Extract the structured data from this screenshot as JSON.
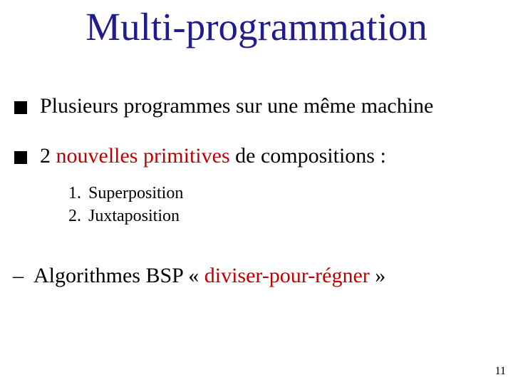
{
  "colors": {
    "title": "#1F1C8E",
    "accent": "#C00000",
    "text": "#000000",
    "bg": "#FFFFFF"
  },
  "title": "Multi-programmation",
  "bullets": [
    {
      "text": "Plusieurs programmes sur une même machine"
    },
    {
      "text_pre": "2 ",
      "text_hl": "nouvelles primitives",
      "text_post": " de compositions :"
    }
  ],
  "sublist": [
    {
      "n": "1.",
      "t": "Superposition"
    },
    {
      "n": "2.",
      "t": "Juxtaposition"
    }
  ],
  "dash": {
    "pre": "Algorithmes BSP « ",
    "hl": "diviser-pour-régner",
    "post": " »"
  },
  "page_number": "11"
}
